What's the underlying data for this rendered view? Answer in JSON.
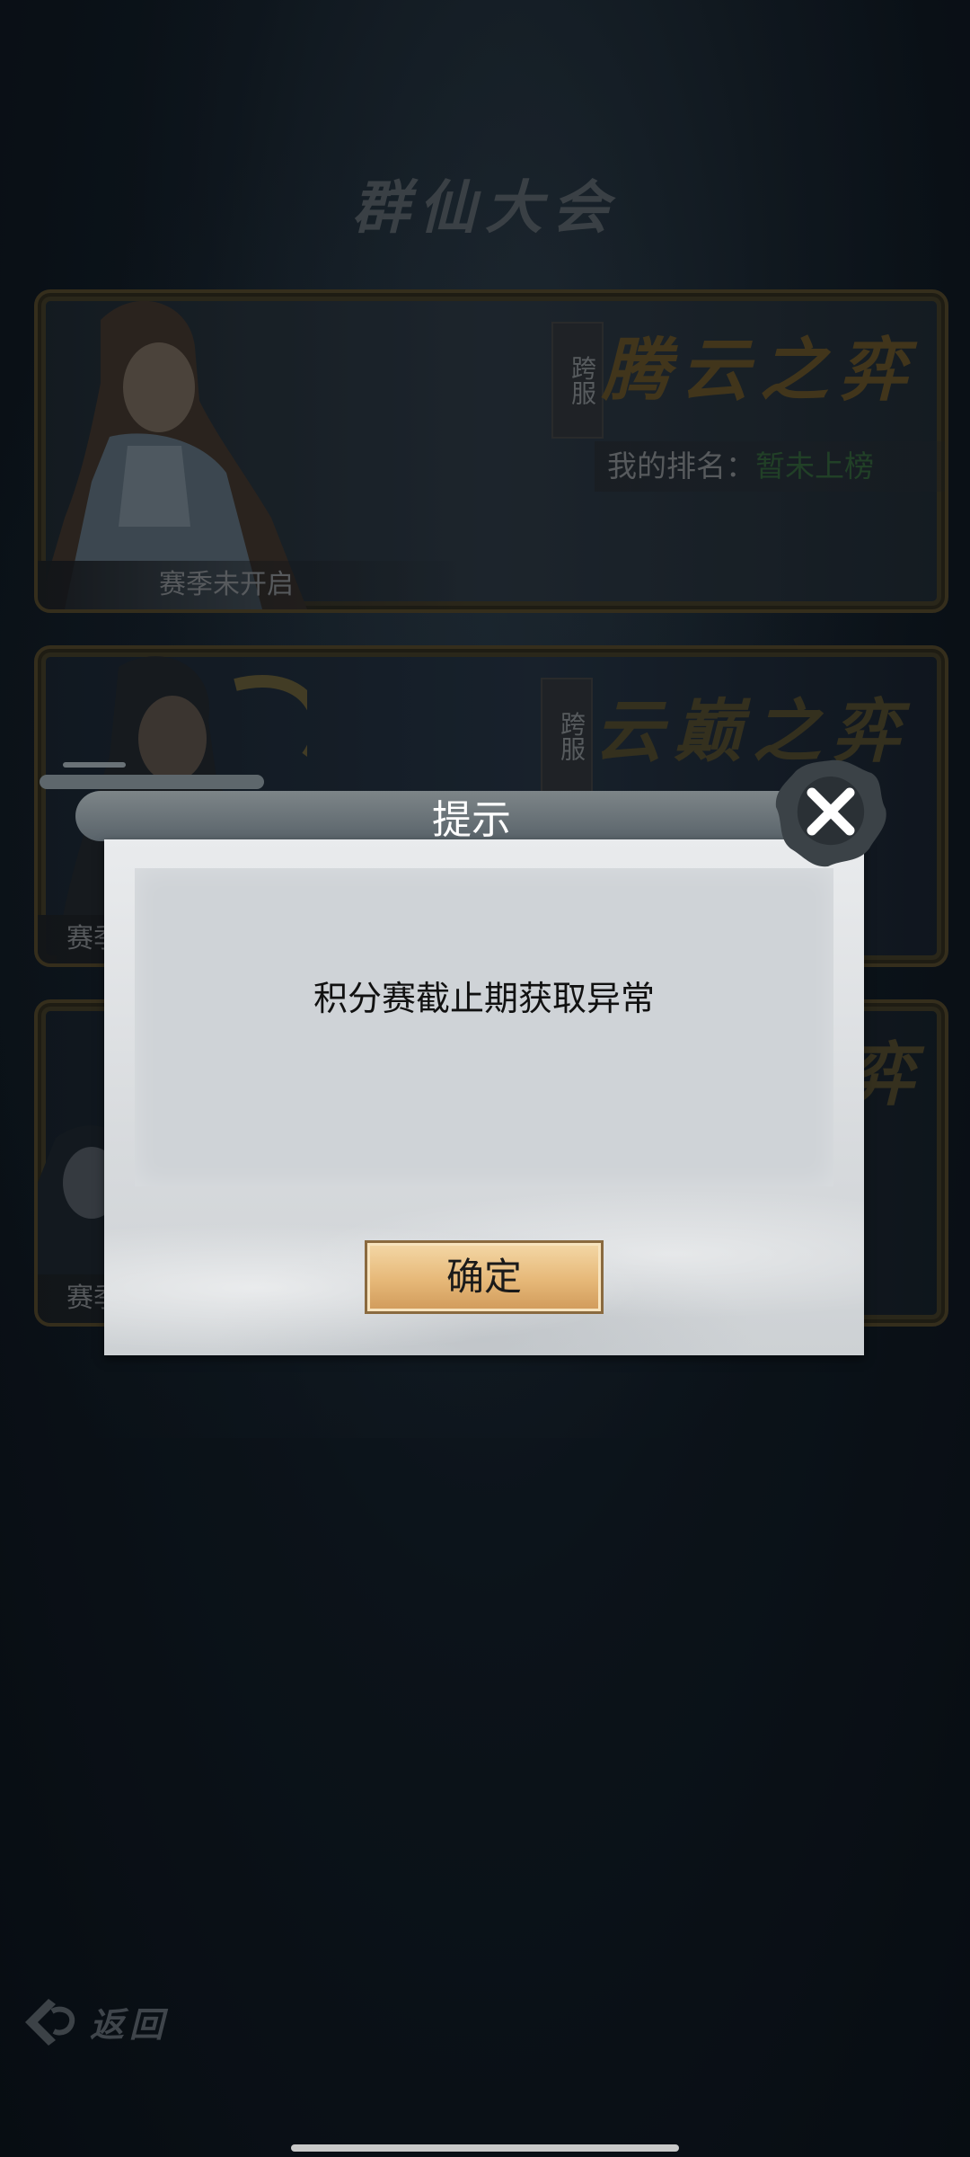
{
  "page": {
    "title": "群仙大会",
    "back_label": "返回"
  },
  "cards": [
    {
      "cross_server": "跨服",
      "event_title": "腾云之弈",
      "rank_label": "我的排名：",
      "rank_value": "暂未上榜",
      "season_status": "赛季未开启"
    },
    {
      "cross_server": "跨服",
      "event_title": "云巅之弈",
      "season_status": "赛季"
    },
    {
      "event_title": "弈",
      "season_status": "赛季"
    }
  ],
  "dialog": {
    "title": "提示",
    "message": "积分赛截止期获取异常",
    "confirm_label": "确定"
  },
  "colors": {
    "gold_title": "#5c4a22",
    "rank_green": "#2f5a33",
    "button_gold": "#e6b878"
  }
}
